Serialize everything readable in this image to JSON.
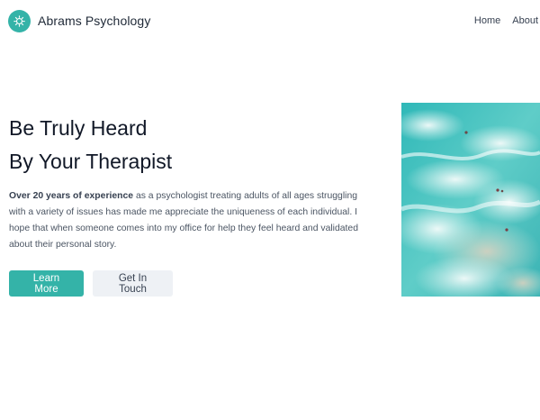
{
  "header": {
    "brand_name": "Abrams Psychology",
    "logo_icon": "brain-icon",
    "nav": [
      {
        "label": "Home"
      },
      {
        "label": "About"
      }
    ]
  },
  "hero": {
    "headline_line1": "Be Truly Heard",
    "headline_line2": "By Your Therapist",
    "lead_bold": "Over 20 years of experience",
    "lead_rest": " as a psychologist treating adults of all ages struggling with a variety of issues has made me appreciate the uniqueness of each individual. I hope that when someone comes into my office for help they feel heard and validated about their personal story.",
    "primary_button": "Learn More",
    "secondary_button": "Get In Touch",
    "image_subject": "aerial-ocean-waves-swimmers"
  },
  "colors": {
    "accent": "#34b3a8",
    "secondary_button_bg": "#eef1f5",
    "text_dark": "#111827",
    "text_muted": "#4b5563"
  }
}
